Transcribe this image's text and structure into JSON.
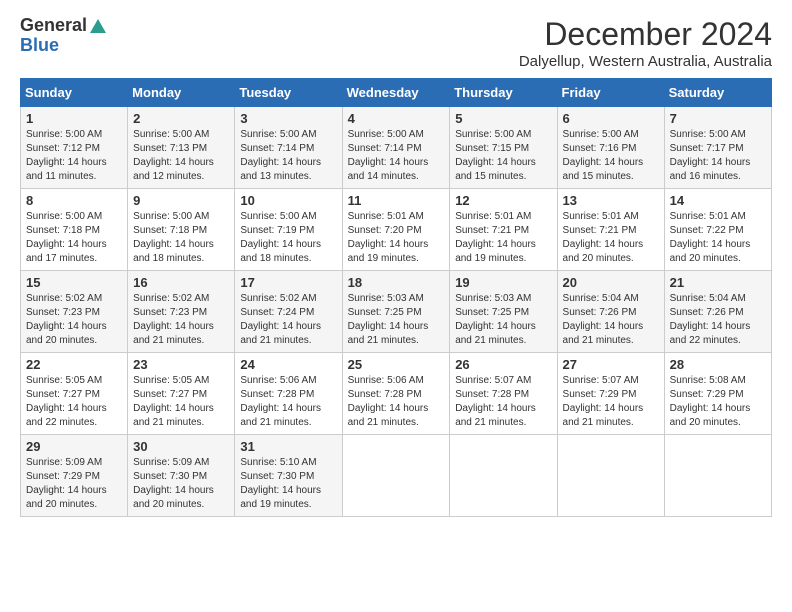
{
  "logo": {
    "general": "General",
    "blue": "Blue"
  },
  "title": "December 2024",
  "location": "Dalyellup, Western Australia, Australia",
  "headers": [
    "Sunday",
    "Monday",
    "Tuesday",
    "Wednesday",
    "Thursday",
    "Friday",
    "Saturday"
  ],
  "weeks": [
    [
      {
        "day": "1",
        "sunrise": "5:00 AM",
        "sunset": "7:12 PM",
        "daylight": "14 hours and 11 minutes."
      },
      {
        "day": "2",
        "sunrise": "5:00 AM",
        "sunset": "7:13 PM",
        "daylight": "14 hours and 12 minutes."
      },
      {
        "day": "3",
        "sunrise": "5:00 AM",
        "sunset": "7:14 PM",
        "daylight": "14 hours and 13 minutes."
      },
      {
        "day": "4",
        "sunrise": "5:00 AM",
        "sunset": "7:14 PM",
        "daylight": "14 hours and 14 minutes."
      },
      {
        "day": "5",
        "sunrise": "5:00 AM",
        "sunset": "7:15 PM",
        "daylight": "14 hours and 15 minutes."
      },
      {
        "day": "6",
        "sunrise": "5:00 AM",
        "sunset": "7:16 PM",
        "daylight": "14 hours and 15 minutes."
      },
      {
        "day": "7",
        "sunrise": "5:00 AM",
        "sunset": "7:17 PM",
        "daylight": "14 hours and 16 minutes."
      }
    ],
    [
      {
        "day": "8",
        "sunrise": "5:00 AM",
        "sunset": "7:18 PM",
        "daylight": "14 hours and 17 minutes."
      },
      {
        "day": "9",
        "sunrise": "5:00 AM",
        "sunset": "7:18 PM",
        "daylight": "14 hours and 18 minutes."
      },
      {
        "day": "10",
        "sunrise": "5:00 AM",
        "sunset": "7:19 PM",
        "daylight": "14 hours and 18 minutes."
      },
      {
        "day": "11",
        "sunrise": "5:01 AM",
        "sunset": "7:20 PM",
        "daylight": "14 hours and 19 minutes."
      },
      {
        "day": "12",
        "sunrise": "5:01 AM",
        "sunset": "7:21 PM",
        "daylight": "14 hours and 19 minutes."
      },
      {
        "day": "13",
        "sunrise": "5:01 AM",
        "sunset": "7:21 PM",
        "daylight": "14 hours and 20 minutes."
      },
      {
        "day": "14",
        "sunrise": "5:01 AM",
        "sunset": "7:22 PM",
        "daylight": "14 hours and 20 minutes."
      }
    ],
    [
      {
        "day": "15",
        "sunrise": "5:02 AM",
        "sunset": "7:23 PM",
        "daylight": "14 hours and 20 minutes."
      },
      {
        "day": "16",
        "sunrise": "5:02 AM",
        "sunset": "7:23 PM",
        "daylight": "14 hours and 21 minutes."
      },
      {
        "day": "17",
        "sunrise": "5:02 AM",
        "sunset": "7:24 PM",
        "daylight": "14 hours and 21 minutes."
      },
      {
        "day": "18",
        "sunrise": "5:03 AM",
        "sunset": "7:25 PM",
        "daylight": "14 hours and 21 minutes."
      },
      {
        "day": "19",
        "sunrise": "5:03 AM",
        "sunset": "7:25 PM",
        "daylight": "14 hours and 21 minutes."
      },
      {
        "day": "20",
        "sunrise": "5:04 AM",
        "sunset": "7:26 PM",
        "daylight": "14 hours and 21 minutes."
      },
      {
        "day": "21",
        "sunrise": "5:04 AM",
        "sunset": "7:26 PM",
        "daylight": "14 hours and 22 minutes."
      }
    ],
    [
      {
        "day": "22",
        "sunrise": "5:05 AM",
        "sunset": "7:27 PM",
        "daylight": "14 hours and 22 minutes."
      },
      {
        "day": "23",
        "sunrise": "5:05 AM",
        "sunset": "7:27 PM",
        "daylight": "14 hours and 21 minutes."
      },
      {
        "day": "24",
        "sunrise": "5:06 AM",
        "sunset": "7:28 PM",
        "daylight": "14 hours and 21 minutes."
      },
      {
        "day": "25",
        "sunrise": "5:06 AM",
        "sunset": "7:28 PM",
        "daylight": "14 hours and 21 minutes."
      },
      {
        "day": "26",
        "sunrise": "5:07 AM",
        "sunset": "7:28 PM",
        "daylight": "14 hours and 21 minutes."
      },
      {
        "day": "27",
        "sunrise": "5:07 AM",
        "sunset": "7:29 PM",
        "daylight": "14 hours and 21 minutes."
      },
      {
        "day": "28",
        "sunrise": "5:08 AM",
        "sunset": "7:29 PM",
        "daylight": "14 hours and 20 minutes."
      }
    ],
    [
      {
        "day": "29",
        "sunrise": "5:09 AM",
        "sunset": "7:29 PM",
        "daylight": "14 hours and 20 minutes."
      },
      {
        "day": "30",
        "sunrise": "5:09 AM",
        "sunset": "7:30 PM",
        "daylight": "14 hours and 20 minutes."
      },
      {
        "day": "31",
        "sunrise": "5:10 AM",
        "sunset": "7:30 PM",
        "daylight": "14 hours and 19 minutes."
      },
      null,
      null,
      null,
      null
    ]
  ],
  "labels": {
    "sunrise": "Sunrise:",
    "sunset": "Sunset:",
    "daylight": "Daylight:"
  }
}
